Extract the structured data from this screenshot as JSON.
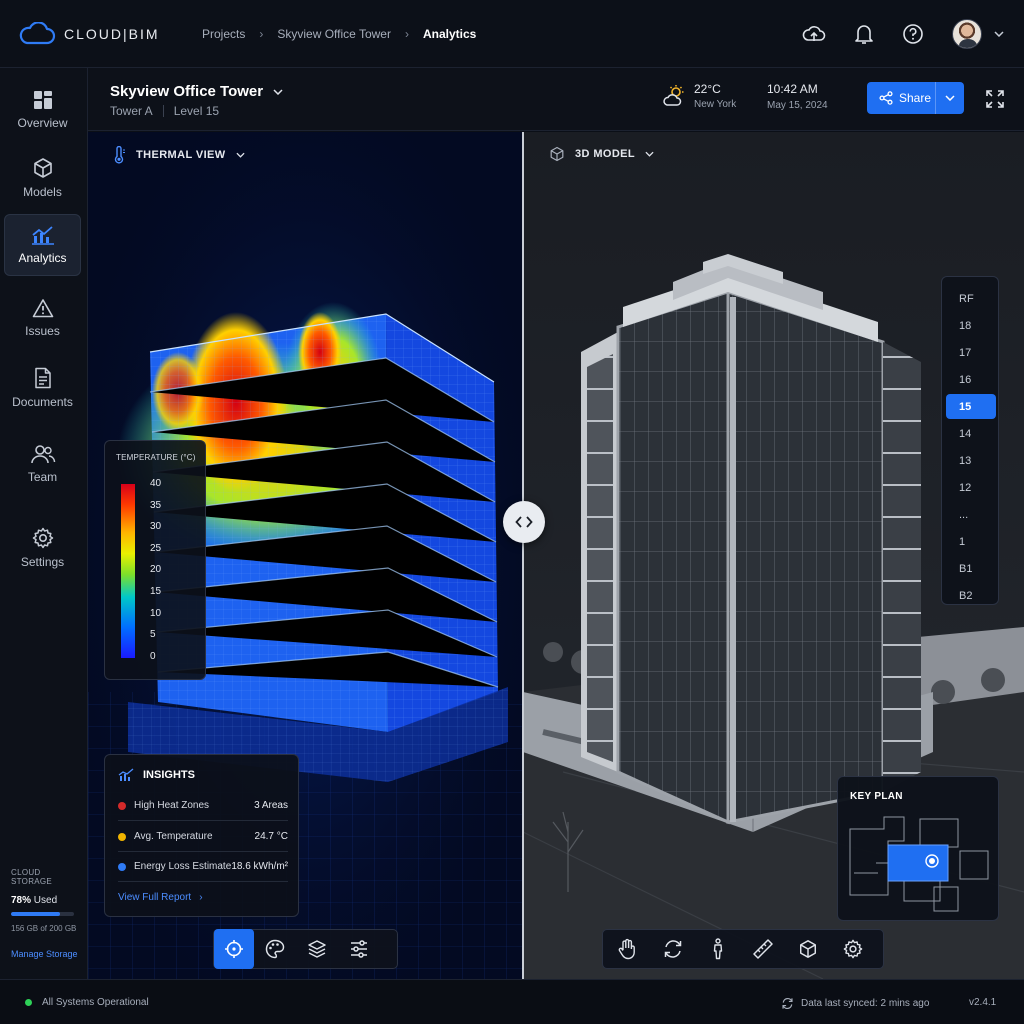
{
  "app": {
    "brand": "CLOUD|BIM"
  },
  "breadcrumbs": [
    {
      "label": "Projects"
    },
    {
      "label": "Skyview Office Tower"
    },
    {
      "label": "Analytics"
    }
  ],
  "sidebar": {
    "items": [
      {
        "label": "Overview",
        "icon": "grid-icon"
      },
      {
        "label": "Models",
        "icon": "cube-icon"
      },
      {
        "label": "Analytics",
        "icon": "chart-icon",
        "active": true
      },
      {
        "label": "Issues",
        "icon": "warning-icon"
      },
      {
        "label": "Documents",
        "icon": "document-icon"
      },
      {
        "label": "Team",
        "icon": "team-icon"
      },
      {
        "label": "Settings",
        "icon": "gear-icon"
      }
    ],
    "storage": {
      "label": "CLOUD STORAGE",
      "percent": "78%",
      "used_word": "Used",
      "fill_fraction": 0.78,
      "size": "156 GB of 200 GB",
      "manage": "Manage Storage"
    }
  },
  "header": {
    "title": "Skyview Office Tower",
    "building": "Tower A",
    "level": "Level 15",
    "weather": {
      "temp": "22°C",
      "city": "New York"
    },
    "time": "10:42 AM",
    "date": "May 15, 2024",
    "share_label": "Share"
  },
  "left_pane": {
    "view_label": "THERMAL VIEW",
    "legend": {
      "title": "TEMPERATURE (°C)",
      "ticks": [
        "40",
        "35",
        "30",
        "25",
        "20",
        "15",
        "10",
        "5",
        "0"
      ]
    },
    "insights": {
      "title": "INSIGHTS",
      "rows": [
        {
          "label": "High Heat Zones",
          "value": "3 Areas",
          "color": "#d42a2a"
        },
        {
          "label": "Avg. Temperature",
          "value": "24.7 °C",
          "color": "#f0b400"
        },
        {
          "label": "Energy Loss Estimate",
          "value": "18.6 kWh/m²",
          "color": "#2f7bf5"
        }
      ],
      "link": "View Full Report"
    },
    "tools": [
      "crosshair-icon",
      "palette-icon",
      "layers-icon",
      "sliders-icon"
    ]
  },
  "right_pane": {
    "view_label": "3D MODEL",
    "levels": [
      "RF",
      "18",
      "17",
      "16",
      "15",
      "14",
      "13",
      "12",
      "...",
      "1",
      "B1",
      "B2"
    ],
    "active_level": "15",
    "keyplan_title": "KEY PLAN",
    "tools": [
      "hand-icon",
      "orbit-icon",
      "walk-icon",
      "measure-icon",
      "cube-icon",
      "gear-icon"
    ]
  },
  "status": {
    "system": "All Systems Operational",
    "sync": "Data last synced: 2 mins ago",
    "version": "v2.4.1"
  },
  "colors": {
    "accent": "#1f6ff2",
    "status_ok": "#2ed158"
  }
}
